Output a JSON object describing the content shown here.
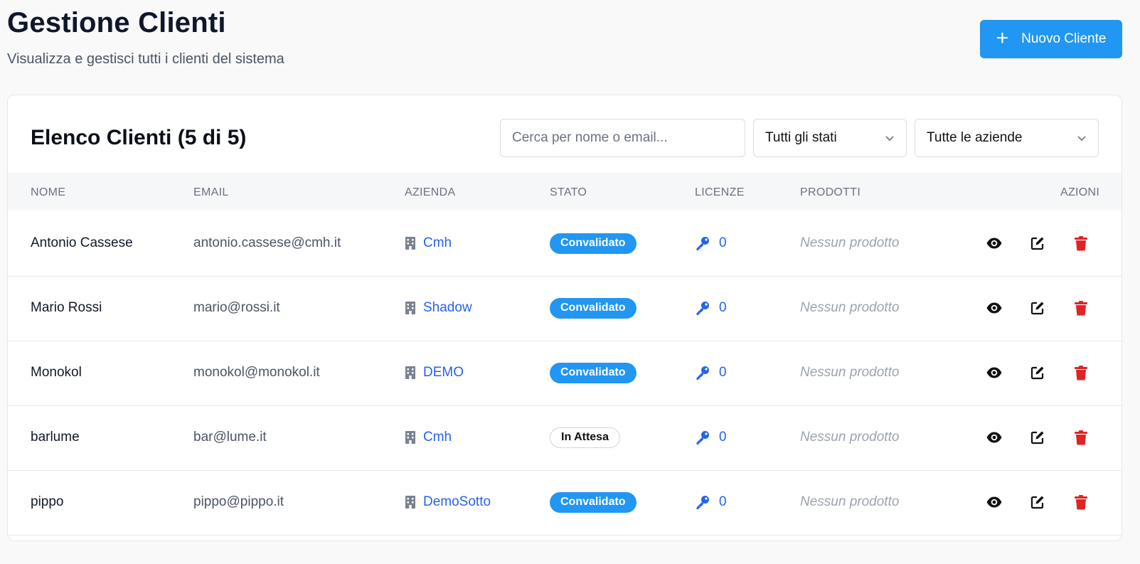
{
  "header": {
    "title": "Gestione Clienti",
    "subtitle": "Visualizza e gestisci tutti i clienti del sistema",
    "new_button": {
      "icon": "plus-icon",
      "label": "Nuovo Cliente"
    }
  },
  "card": {
    "title": "Elenco Clienti (5 di 5)",
    "search": {
      "placeholder": "Cerca per nome o email...",
      "value": ""
    },
    "status_filter": {
      "selected": "Tutti gli stati"
    },
    "company_filter": {
      "selected": "Tutte le aziende"
    }
  },
  "table": {
    "columns": [
      "NOME",
      "EMAIL",
      "AZIENDA",
      "STATO",
      "LICENZE",
      "PRODOTTI",
      "AZIONI"
    ],
    "rows": [
      {
        "name": "Antonio Cassese",
        "email": "antonio.cassese@cmh.it",
        "company": "Cmh",
        "status": "Convalidato",
        "status_kind": "valid",
        "licenses": "0",
        "products": "Nessun prodotto"
      },
      {
        "name": "Mario Rossi",
        "email": "mario@rossi.it",
        "company": "Shadow",
        "status": "Convalidato",
        "status_kind": "valid",
        "licenses": "0",
        "products": "Nessun prodotto"
      },
      {
        "name": "Monokol",
        "email": "monokol@monokol.it",
        "company": "DEMO",
        "status": "Convalidato",
        "status_kind": "valid",
        "licenses": "0",
        "products": "Nessun prodotto"
      },
      {
        "name": "barlume",
        "email": "bar@lume.it",
        "company": "Cmh",
        "status": "In Attesa",
        "status_kind": "pending",
        "licenses": "0",
        "products": "Nessun prodotto"
      },
      {
        "name": "pippo",
        "email": "pippo@pippo.it",
        "company": "DemoSotto",
        "status": "Convalidato",
        "status_kind": "valid",
        "licenses": "0",
        "products": "Nessun prodotto"
      }
    ]
  },
  "colors": {
    "primary": "#2196f3",
    "link": "#2563eb",
    "danger": "#e02424",
    "muted": "#9ca3af"
  }
}
